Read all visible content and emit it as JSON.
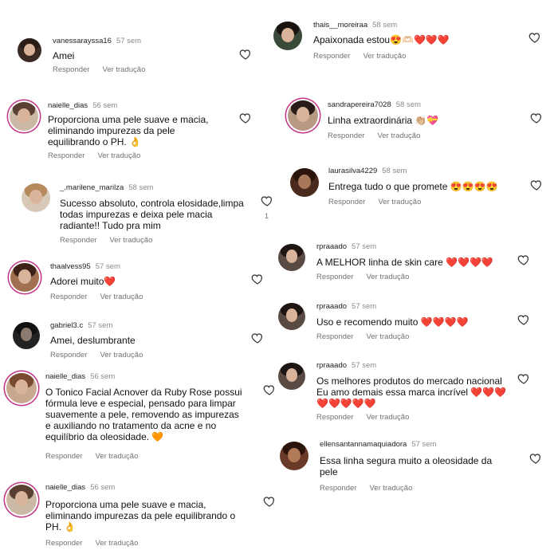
{
  "labels": {
    "reply": "Responder",
    "translate": "Ver tradução"
  },
  "colors": {
    "heart_filled": "#e0245e",
    "muted": "#737373",
    "story_ring": "#c13584"
  },
  "left_comments": [
    {
      "user": "vanessarayssa16",
      "time": "57 sem",
      "text": "Amei"
    },
    {
      "user": "naielle_dias",
      "time": "56 sem",
      "text": "Proporciona uma pele suave e macia, eliminando impurezas da pele equilibrando o PH. 👌"
    },
    {
      "user": "_.marilene_marilza",
      "time": "58 sem",
      "text": "Sucesso absoluto, controla elosidade,limpa todas impurezas e deixa pele macia radiante!! Tudo pra mim",
      "likes": "1"
    },
    {
      "user": "thaalvess95",
      "time": "57 sem",
      "text": "Adorei muito❤️"
    },
    {
      "user": "gabriel3.c",
      "time": "57 sem",
      "text": "Amei, deslumbrante"
    },
    {
      "user": "naielle_dias",
      "time": "56 sem",
      "text": "O Tonico Facial Acnover da Ruby Rose possui fórmula leve e especial, pensado para limpar suavemente a pele, removendo as impurezas e auxiliando no tratamento da acne e no equilíbrio da oleosidade. 🧡"
    },
    {
      "user": "naielle_dias",
      "time": "56 sem",
      "text": "Proporciona uma pele suave e macia, eliminando impurezas da pele equilibrando o PH. 👌"
    }
  ],
  "right_comments": [
    {
      "user": "thais__moreiraa",
      "time": "58 sem",
      "text": "Apaixonada estou😍🫶🏻❤️❤️❤️"
    },
    {
      "user": "sandrapereira7028",
      "time": "58 sem",
      "text": "Linha extraordinária 👏🏼💝"
    },
    {
      "user": "laurasilva4229",
      "time": "58 sem",
      "text": "Entrega tudo o que promete 😍😍😍😍"
    },
    {
      "user": "rpraaado",
      "time": "57 sem",
      "text": "A MELHOR linha de skin care ❤️❤️❤️❤️"
    },
    {
      "user": "rpraaado",
      "time": "57 sem",
      "text": "Uso e recomendo muito ❤️❤️❤️❤️"
    },
    {
      "user": "rpraaado",
      "time": "57 sem",
      "text": "Os melhores produtos do mercado nacional Eu amo demais essa marca incrível ❤️❤️❤️❤️❤️❤️❤️❤️"
    },
    {
      "user": "ellensantannamaquiadora",
      "time": "57 sem",
      "text": "Essa linha segura muito a oleosidade da pele"
    }
  ]
}
